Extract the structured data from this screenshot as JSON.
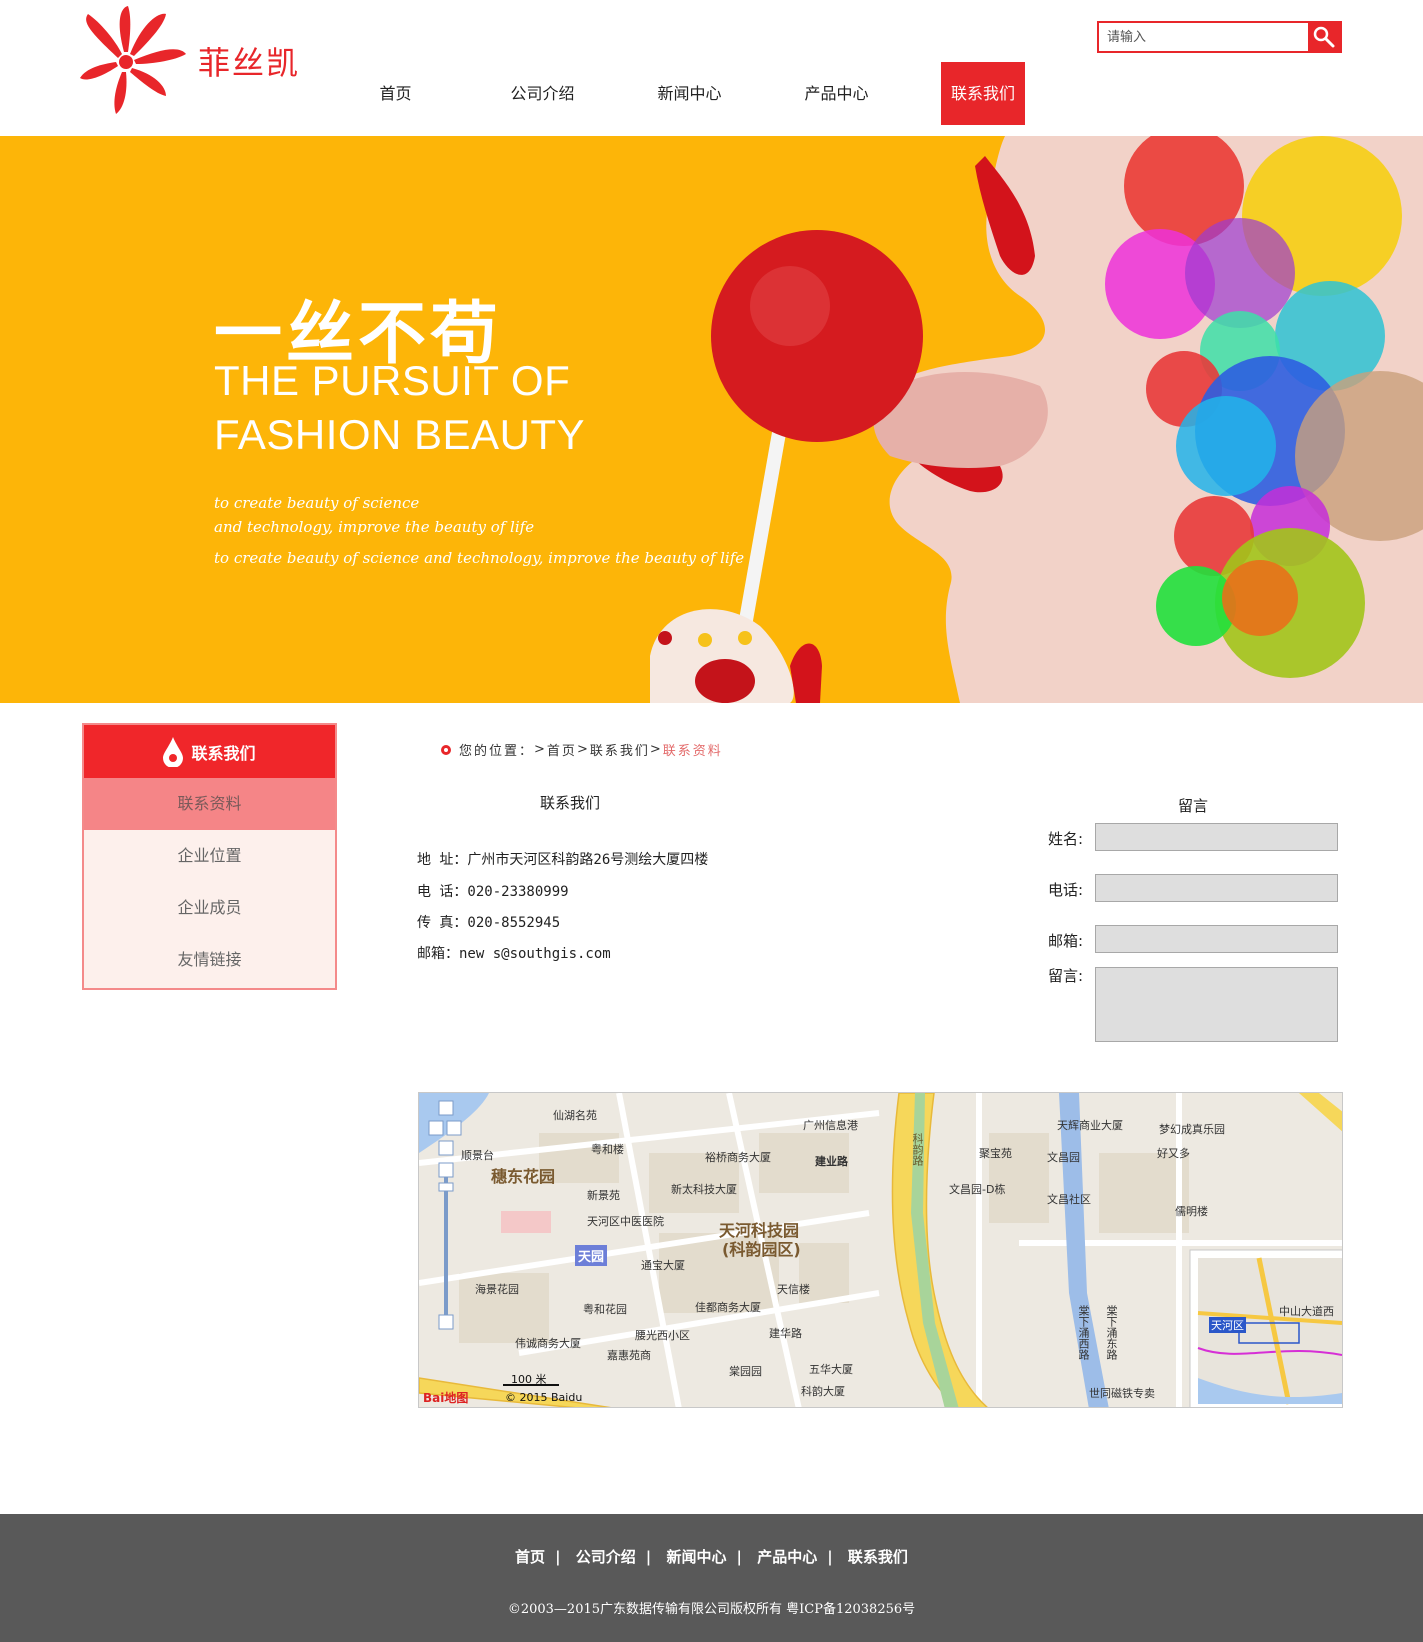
{
  "brand": {
    "name": "菲丝凯",
    "accent": "#e8262a"
  },
  "search": {
    "placeholder": "请输入",
    "icon": "magnifier-icon"
  },
  "nav": [
    {
      "label": "首页"
    },
    {
      "label": "公司介绍"
    },
    {
      "label": "新闻中心"
    },
    {
      "label": "产品中心"
    },
    {
      "label": "联系我们",
      "active": true
    }
  ],
  "banner": {
    "title_cn": "一丝不苟",
    "title_en_1": "THE PURSUIT OF",
    "title_en_2": "FASHION BEAUTY",
    "sub_1": "to create beauty of science",
    "sub_2": "and technology, improve the beauty of life",
    "sub_3": "to create beauty of science and technology, improve the beauty of life",
    "background": "#fdb508"
  },
  "sidebar": {
    "title": "联系我们",
    "items": [
      {
        "label": "联系资料",
        "active": true
      },
      {
        "label": "企业位置"
      },
      {
        "label": "企业成员"
      },
      {
        "label": "友情链接"
      }
    ]
  },
  "breadcrumb": {
    "prefix": "您的位置：",
    "sep": ">",
    "home": "首页",
    "section": "联系我们",
    "current": "联系资料"
  },
  "contact": {
    "title": "联系我们",
    "address": "地  址：广州市天河区科韵路26号测绘大厦四楼",
    "phone": "电  话：020-23380999",
    "fax": "传  真：020-8552945",
    "email": "邮箱：new s@southgis.com"
  },
  "message_form": {
    "title": "留言",
    "name_label": "姓名:",
    "phone_label": "电话:",
    "email_label": "邮箱:",
    "message_label": "留言:"
  },
  "map": {
    "labels": {
      "tianhe_park": "天河科技园",
      "tianhe_park_sub": "(科韵园区)",
      "suidong": "穗东花园",
      "tianyuan": "天园",
      "xianyu": "仙湖名苑",
      "yuehe": "粤和楼",
      "yuqiao": "裕桥商务大厦",
      "xinsenyuan": "新景苑",
      "xintaike": "新太科技大厦",
      "hospital": "天河区中医医院",
      "guangzhou_info": "广州信息港",
      "jianye": "建业路",
      "keyun_1": "科韵路",
      "tianhe_comm": "天辉商业大厦",
      "juzhuyuan": "聚宝苑",
      "wenchangyuan": "文昌园",
      "wenchang_d": "文昌园-D栋",
      "wenchang_comm": "文昌社区",
      "menghuan": "梦幻成真乐园",
      "haoyouduo": "好又多",
      "ruming": "儒明楼",
      "shunjingtai": "顺景台",
      "haijing": "海景花园",
      "yuehe_garden": "粤和花园",
      "yongtai": "通宝大厦",
      "tianxin": "天信楼",
      "jiadu": "佳都商务大厦",
      "weicheng": "伟诚商务大厦",
      "tanguang": "腰光西小区",
      "jianhua": "建华路",
      "jiahui": "嘉惠苑商",
      "tangyuan": "棠园园",
      "wuhua": "五华大厦",
      "keyun_bldg": "科韵大厦",
      "shenggang": "世同磁铁专卖",
      "tangxia_w": "棠下涌西路",
      "tangxia_e": "棠下涌东路",
      "tianhe_district": "天河区",
      "zhongshan": "中山大道西",
      "scale": "100 米",
      "copyright": "© 2015 Baidu",
      "logo": "Bai地图"
    }
  },
  "footer": {
    "links": [
      "首页",
      "公司介绍",
      "新闻中心",
      "产品中心",
      "联系我们"
    ],
    "sep": "|",
    "copyright": "©2003—2015广东数据传输有限公司版权所有  粤ICP备12038256号",
    "background": "#595959"
  }
}
